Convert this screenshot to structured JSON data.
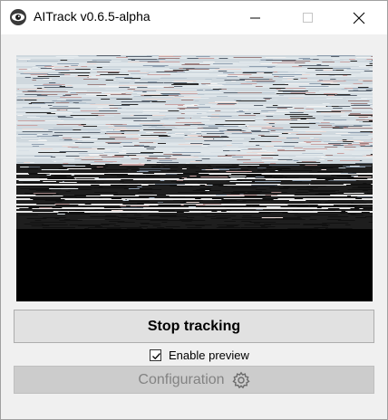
{
  "window": {
    "title": "AITrack v0.6.5-alpha",
    "controls": [
      "minimize-icon",
      "maximize-icon",
      "close-icon"
    ]
  },
  "preview": {
    "content": "camera feed (distorted)",
    "colors": {
      "black": "#000000",
      "pink": "#c9a3a3",
      "light": "#dfe8ee",
      "blue_gray": "#7d8fa2"
    }
  },
  "actions": {
    "stop_label": "Stop tracking",
    "preview_toggle_label": "Enable preview",
    "preview_enabled": true,
    "config_label": "Configuration",
    "config_enabled": false
  }
}
